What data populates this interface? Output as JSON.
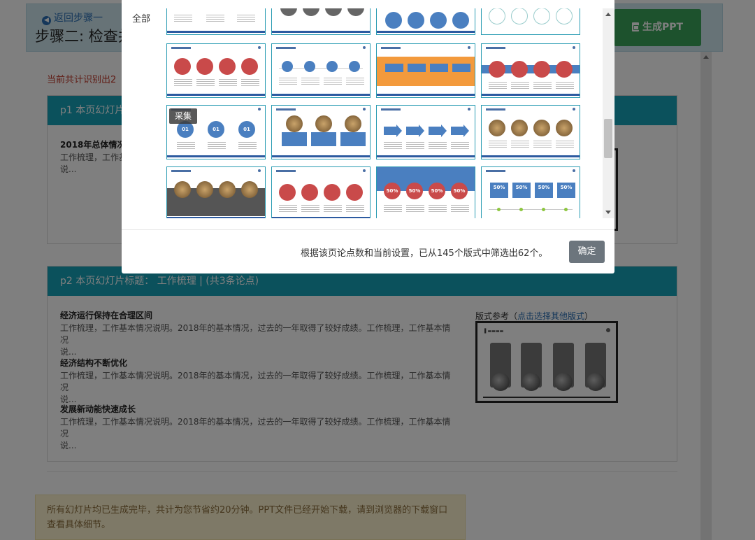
{
  "header": {
    "back_label": "返回步骤一",
    "title": "步骤二: 检查并",
    "generate_label": "生成PPT"
  },
  "count_note": "当前共计识别出2",
  "slides": [
    {
      "title": "p1 本页幻灯片",
      "points": [
        {
          "heading": "2018年总体情况",
          "body": "工作梳理，工作基",
          "body2": "说..."
        }
      ]
    },
    {
      "title": "p2 本页幻灯片标题： 工作梳理 | (共3条论点)",
      "points": [
        {
          "heading": "经济运行保持在合理区间",
          "body": "工作梳理，工作基本情况说明。2018年的基本情况，过去的一年取得了较好成绩。工作梳理，工作基本情况",
          "body2": "说..."
        },
        {
          "heading": "经济结构不断优化",
          "body": "工作梳理，工作基本情况说明。2018年的基本情况，过去的一年取得了较好成绩。工作梳理，工作基本情况",
          "body2": "说..."
        },
        {
          "heading": "发展新动能快速成长",
          "body": "工作梳理，工作基本情况说明。2018年的基本情况，过去的一年取得了较好成绩。工作梳理，工作基本情况",
          "body2": "说..."
        }
      ],
      "layout_ref_label": "版式参考",
      "layout_ref_paren_open": "（",
      "layout_ref_link": "点击选择其他版式",
      "layout_ref_paren_close": "）"
    }
  ],
  "done_alert": "所有幻灯片均已生成完毕，共计为您节省约20分钟。PPT文件已经开始下载，请到浏览器的下载窗口查看具体细节。",
  "modal": {
    "filter_label": "全部",
    "collect_label": "采集",
    "summary": "根据该页论点数和当前设置，已从145个版式中筛选出62个。",
    "confirm_label": "确定",
    "template_texts": {
      "num_01": "01",
      "pct_50": "50%"
    }
  },
  "colors": {
    "accent": "#17a2b8",
    "generate": "#3aa55a",
    "alert_bg": "#fcf2cf",
    "confirm": "#6c757d"
  }
}
